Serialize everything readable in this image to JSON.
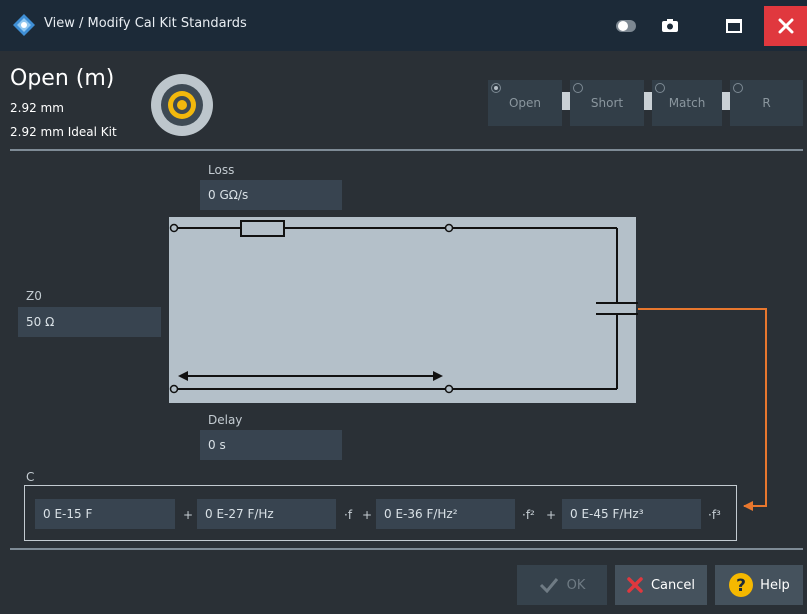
{
  "window": {
    "title": "View / Modify Cal Kit Standards"
  },
  "standard": {
    "name": "Open (m)",
    "connector": "2.92 mm",
    "kit": "2.92 mm Ideal Kit"
  },
  "types": [
    {
      "label": "Open",
      "selected": true
    },
    {
      "label": "Short",
      "selected": false
    },
    {
      "label": "Match",
      "selected": false
    },
    {
      "label": "R",
      "selected": false
    }
  ],
  "loss": {
    "label": "Loss",
    "value": "0 GΩ/s"
  },
  "z0": {
    "label": "Z0",
    "value": "50 Ω"
  },
  "delay": {
    "label": "Delay",
    "value": "0 s"
  },
  "c": {
    "label": "C",
    "c0": "0 E-15 F",
    "c1": "0 E-27 F/Hz",
    "c2": "0 E-36 F/Hz²",
    "c3": "0 E-45 F/Hz³",
    "plus": "+",
    "f1": "·f",
    "f2": "·f²",
    "f3": "·f³"
  },
  "buttons": {
    "ok": "OK",
    "cancel": "Cancel",
    "help": "Help"
  },
  "colors": {
    "accent": "#e8772e",
    "close": "#e0383e",
    "help": "#f5b800"
  }
}
